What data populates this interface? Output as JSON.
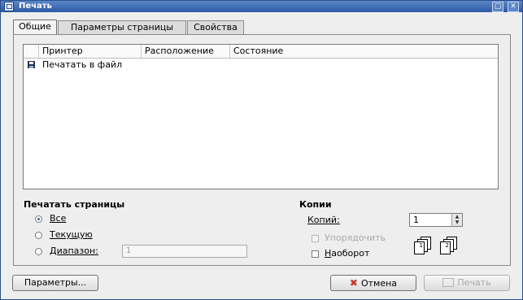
{
  "window": {
    "title": "Печать"
  },
  "tabs": [
    {
      "label": "Общие",
      "active": true
    },
    {
      "label": "Параметры страницы",
      "active": false
    },
    {
      "label": "Свойства",
      "active": false
    }
  ],
  "printers": {
    "columns": [
      "Принтер",
      "Расположение",
      "Состояние"
    ],
    "rows": [
      {
        "icon": "floppy-disk-icon",
        "name": "Печатать в файл",
        "location": "",
        "status": ""
      }
    ]
  },
  "pages_section": {
    "title": "Печатать страницы",
    "options": [
      {
        "label": "Все",
        "selected": true
      },
      {
        "label": "Текущую",
        "selected": false
      },
      {
        "label": "Диапазон:",
        "selected": false
      }
    ],
    "range_value": "1"
  },
  "copies_section": {
    "title": "Копии",
    "copies_label": "Копий:",
    "copies_value": "1",
    "collate_label": "Упорядочить",
    "collate_checked": false,
    "collate_enabled": false,
    "reverse_label": "Наоборот",
    "reverse_checked": false,
    "collate_preview": [
      "1",
      "2"
    ]
  },
  "buttons": {
    "params": "Параметры...",
    "cancel": "Отмена",
    "print": "Печать"
  }
}
